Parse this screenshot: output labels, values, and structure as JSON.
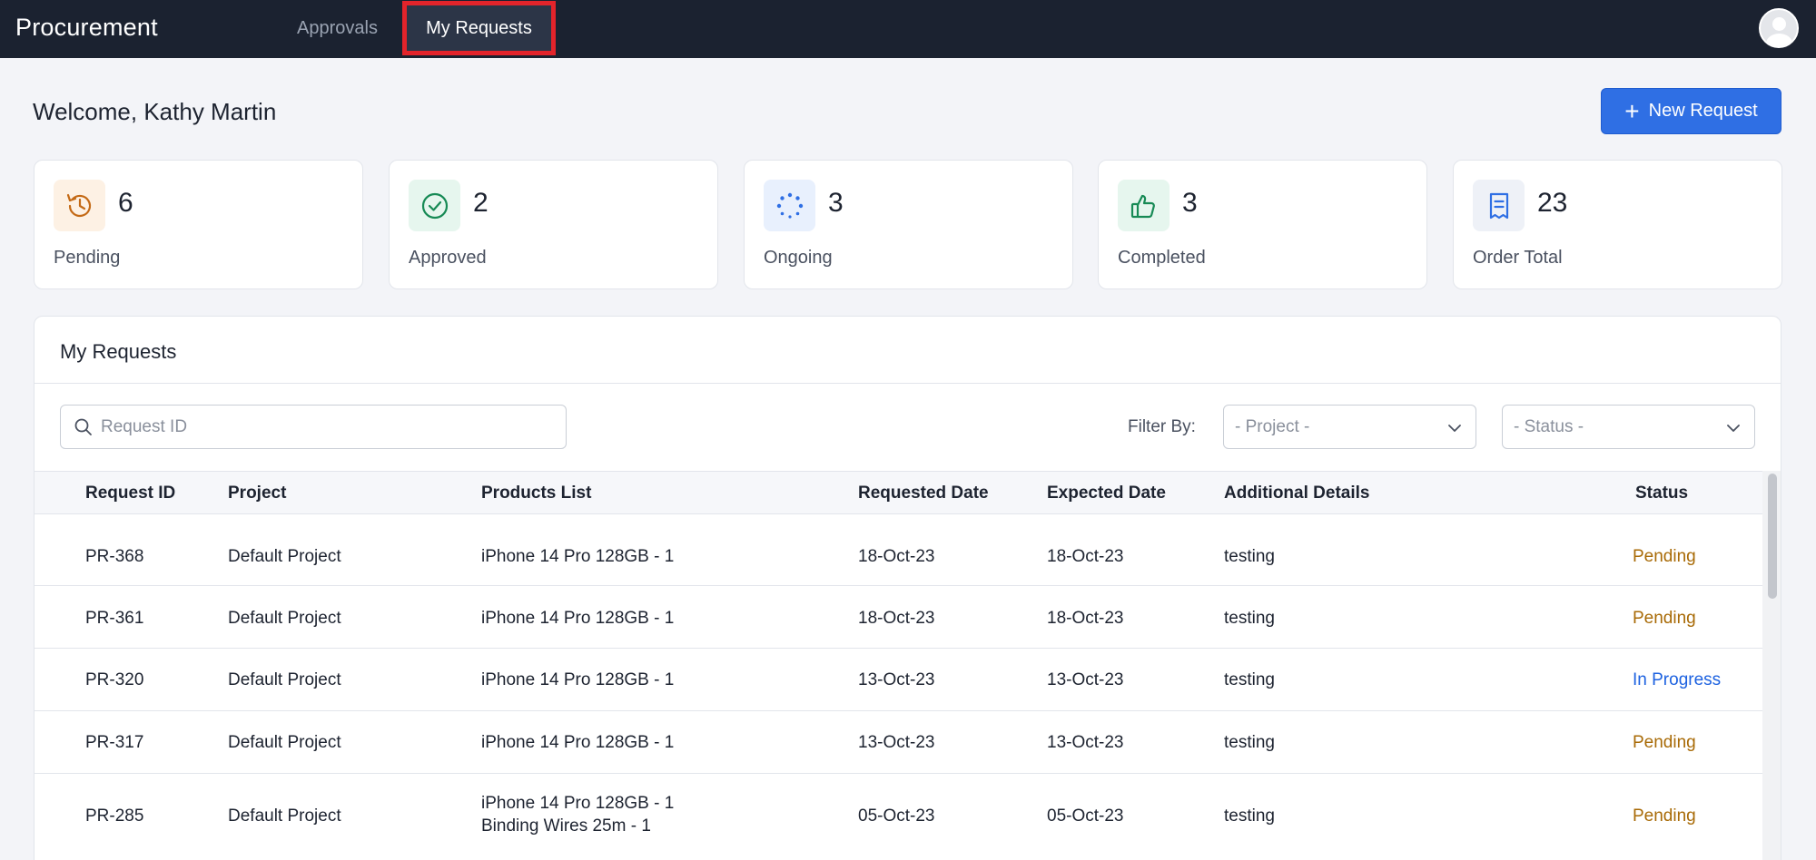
{
  "app": {
    "title": "Procurement",
    "tabs": [
      {
        "label": "Approvals",
        "active": false
      },
      {
        "label": "My Requests",
        "active": true
      }
    ]
  },
  "header": {
    "welcome": "Welcome, Kathy Martin",
    "new_request_label": "New Request"
  },
  "stats": [
    {
      "value": "6",
      "label": "Pending",
      "icon": "history-icon",
      "color": "#c46a16",
      "bg": "#fdf1e4"
    },
    {
      "value": "2",
      "label": "Approved",
      "icon": "check-circle-icon",
      "color": "#178a55",
      "bg": "#e6f6ee"
    },
    {
      "value": "3",
      "label": "Ongoing",
      "icon": "loading-dots-icon",
      "color": "#2f6fe4",
      "bg": "#e8f0fd"
    },
    {
      "value": "3",
      "label": "Completed",
      "icon": "thumbs-up-icon",
      "color": "#178a55",
      "bg": "#e6f6ee"
    },
    {
      "value": "23",
      "label": "Order Total",
      "icon": "receipt-icon",
      "color": "#2f6fe4",
      "bg": "#eef1f7"
    }
  ],
  "requests": {
    "title": "My Requests",
    "search_placeholder": "Request ID",
    "filter_label": "Filter By:",
    "project_select": "- Project -",
    "status_select": "- Status -",
    "columns": [
      "Request ID",
      "Project",
      "Products List",
      "Requested Date",
      "Expected Date",
      "Additional Details",
      "Status"
    ],
    "rows": [
      {
        "id": "PR-368",
        "project": "Default Project",
        "products": [
          "iPhone 14 Pro 128GB - 1"
        ],
        "requested": "18-Oct-23",
        "expected": "18-Oct-23",
        "details": "testing",
        "status": "Pending"
      },
      {
        "id": "PR-361",
        "project": "Default Project",
        "products": [
          "iPhone 14 Pro 128GB - 1"
        ],
        "requested": "18-Oct-23",
        "expected": "18-Oct-23",
        "details": "testing",
        "status": "Pending"
      },
      {
        "id": "PR-320",
        "project": "Default Project",
        "products": [
          "iPhone 14 Pro 128GB - 1"
        ],
        "requested": "13-Oct-23",
        "expected": "13-Oct-23",
        "details": "testing",
        "status": "In Progress"
      },
      {
        "id": "PR-317",
        "project": "Default Project",
        "products": [
          "iPhone 14 Pro 128GB - 1"
        ],
        "requested": "13-Oct-23",
        "expected": "13-Oct-23",
        "details": "testing",
        "status": "Pending"
      },
      {
        "id": "PR-285",
        "project": "Default Project",
        "products": [
          "iPhone 14 Pro 128GB - 1",
          "Binding Wires 25m - 1"
        ],
        "requested": "05-Oct-23",
        "expected": "05-Oct-23",
        "details": "testing",
        "status": "Pending"
      }
    ]
  },
  "colors": {
    "topbar": "#1b2230",
    "accent": "#2f6fe4",
    "pending": "#a86a06",
    "in_progress": "#1d62e0",
    "highlight": "#e3242b"
  }
}
